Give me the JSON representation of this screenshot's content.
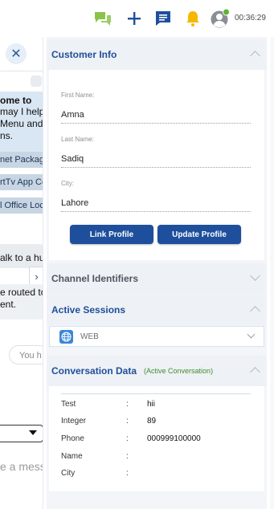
{
  "topbar": {
    "icons": [
      "chat-bubbles-icon",
      "plus-icon",
      "message-icon",
      "bell-icon",
      "user-avatar-icon"
    ],
    "clock": "00:36:29",
    "colors": {
      "chat": "#8bc34a",
      "plus": "#1e4f9c",
      "message": "#1e4f9c",
      "bell": "#f5b800",
      "status": "#5bb531"
    }
  },
  "chat": {
    "close_glyph": "✕",
    "welcome_line1": "ome to",
    "welcome_line2": "may I help",
    "welcome_line3": "Menu and",
    "welcome_line4": "ns.",
    "menu_items": [
      "net Package",
      "rtTv App Co",
      "l Office Loc"
    ],
    "bot_text": "alk to a hu",
    "expand_glyph": "›",
    "routed_line1": "e routed to",
    "routed_line2": "ent.",
    "you_pill": "You h",
    "input_placeholder": "e a mess"
  },
  "customer_info": {
    "title": "Customer Info",
    "fields": [
      {
        "label": "First Name:",
        "value": "Amna"
      },
      {
        "label": "Last Name:",
        "value": "Sadiq"
      },
      {
        "label": "City:",
        "value": "Lahore"
      }
    ],
    "link_button": "Link Profile",
    "update_button": "Update Profile"
  },
  "channel_identifiers": {
    "title": "Channel Identifiers"
  },
  "active_sessions": {
    "title": "Active Sessions",
    "session": "WEB"
  },
  "conversation_data": {
    "title": "Conversation Data",
    "subtitle": "(Active Conversation)",
    "rows": [
      {
        "key": "Test",
        "value": "hii"
      },
      {
        "key": "Integer",
        "value": "89"
      },
      {
        "key": "Phone",
        "value": "000999100000"
      },
      {
        "key": "Name",
        "value": ""
      },
      {
        "key": "City",
        "value": ""
      }
    ]
  }
}
